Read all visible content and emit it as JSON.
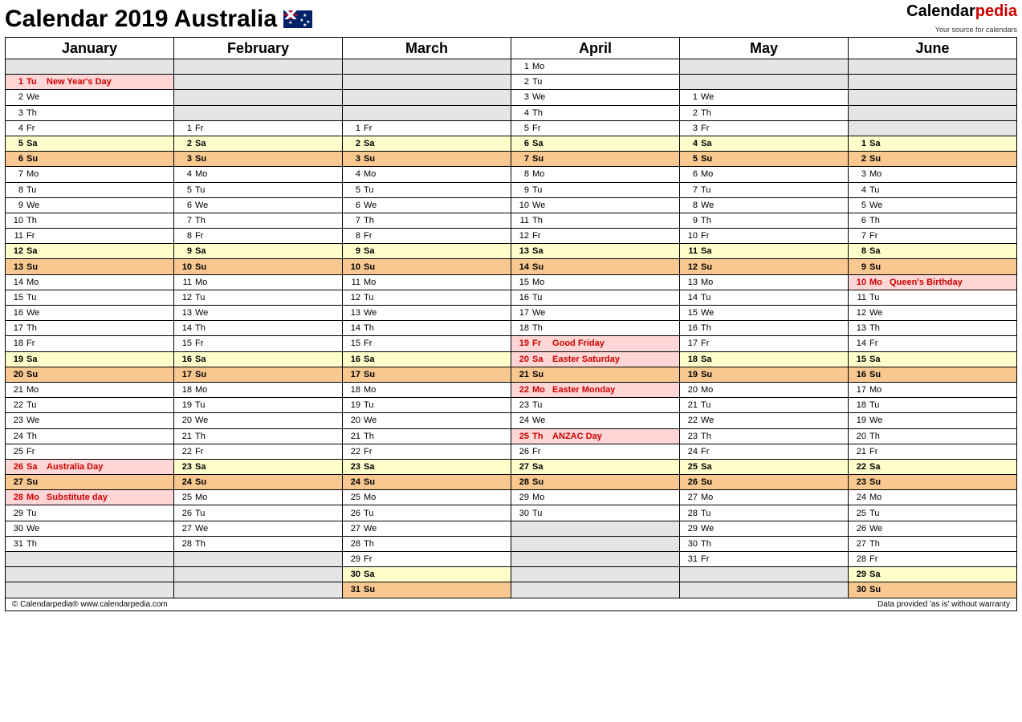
{
  "title": "Calendar 2019 Australia",
  "brand": {
    "name": "Calendar",
    "suffix": "pedia",
    "tagline": "Your source for calendars"
  },
  "footer": {
    "left": "© Calendarpedia®   www.calendarpedia.com",
    "right": "Data provided 'as is' without warranty"
  },
  "months": [
    "January",
    "February",
    "March",
    "April",
    "May",
    "June"
  ],
  "rows": 35,
  "grid": {
    "January": [
      null,
      {
        "d": 1,
        "w": "Tu",
        "t": "hol",
        "lbl": "New Year's Day"
      },
      {
        "d": 2,
        "w": "We"
      },
      {
        "d": 3,
        "w": "Th"
      },
      {
        "d": 4,
        "w": "Fr"
      },
      {
        "d": 5,
        "w": "Sa",
        "t": "sat"
      },
      {
        "d": 6,
        "w": "Su",
        "t": "sun"
      },
      {
        "d": 7,
        "w": "Mo"
      },
      {
        "d": 8,
        "w": "Tu"
      },
      {
        "d": 9,
        "w": "We"
      },
      {
        "d": 10,
        "w": "Th"
      },
      {
        "d": 11,
        "w": "Fr"
      },
      {
        "d": 12,
        "w": "Sa",
        "t": "sat"
      },
      {
        "d": 13,
        "w": "Su",
        "t": "sun"
      },
      {
        "d": 14,
        "w": "Mo"
      },
      {
        "d": 15,
        "w": "Tu"
      },
      {
        "d": 16,
        "w": "We"
      },
      {
        "d": 17,
        "w": "Th"
      },
      {
        "d": 18,
        "w": "Fr"
      },
      {
        "d": 19,
        "w": "Sa",
        "t": "sat"
      },
      {
        "d": 20,
        "w": "Su",
        "t": "sun"
      },
      {
        "d": 21,
        "w": "Mo"
      },
      {
        "d": 22,
        "w": "Tu"
      },
      {
        "d": 23,
        "w": "We"
      },
      {
        "d": 24,
        "w": "Th"
      },
      {
        "d": 25,
        "w": "Fr"
      },
      {
        "d": 26,
        "w": "Sa",
        "t": "hol",
        "lbl": "Australia Day"
      },
      {
        "d": 27,
        "w": "Su",
        "t": "sun"
      },
      {
        "d": 28,
        "w": "Mo",
        "t": "hol",
        "lbl": "Substitute day"
      },
      {
        "d": 29,
        "w": "Tu"
      },
      {
        "d": 30,
        "w": "We"
      },
      {
        "d": 31,
        "w": "Th"
      },
      null,
      null,
      null
    ],
    "February": [
      null,
      null,
      null,
      null,
      {
        "d": 1,
        "w": "Fr"
      },
      {
        "d": 2,
        "w": "Sa",
        "t": "sat"
      },
      {
        "d": 3,
        "w": "Su",
        "t": "sun"
      },
      {
        "d": 4,
        "w": "Mo"
      },
      {
        "d": 5,
        "w": "Tu"
      },
      {
        "d": 6,
        "w": "We"
      },
      {
        "d": 7,
        "w": "Th"
      },
      {
        "d": 8,
        "w": "Fr"
      },
      {
        "d": 9,
        "w": "Sa",
        "t": "sat"
      },
      {
        "d": 10,
        "w": "Su",
        "t": "sun"
      },
      {
        "d": 11,
        "w": "Mo"
      },
      {
        "d": 12,
        "w": "Tu"
      },
      {
        "d": 13,
        "w": "We"
      },
      {
        "d": 14,
        "w": "Th"
      },
      {
        "d": 15,
        "w": "Fr"
      },
      {
        "d": 16,
        "w": "Sa",
        "t": "sat"
      },
      {
        "d": 17,
        "w": "Su",
        "t": "sun"
      },
      {
        "d": 18,
        "w": "Mo"
      },
      {
        "d": 19,
        "w": "Tu"
      },
      {
        "d": 20,
        "w": "We"
      },
      {
        "d": 21,
        "w": "Th"
      },
      {
        "d": 22,
        "w": "Fr"
      },
      {
        "d": 23,
        "w": "Sa",
        "t": "sat"
      },
      {
        "d": 24,
        "w": "Su",
        "t": "sun"
      },
      {
        "d": 25,
        "w": "Mo"
      },
      {
        "d": 26,
        "w": "Tu"
      },
      {
        "d": 27,
        "w": "We"
      },
      {
        "d": 28,
        "w": "Th"
      },
      null,
      null,
      null
    ],
    "March": [
      null,
      null,
      null,
      null,
      {
        "d": 1,
        "w": "Fr"
      },
      {
        "d": 2,
        "w": "Sa",
        "t": "sat"
      },
      {
        "d": 3,
        "w": "Su",
        "t": "sun"
      },
      {
        "d": 4,
        "w": "Mo"
      },
      {
        "d": 5,
        "w": "Tu"
      },
      {
        "d": 6,
        "w": "We"
      },
      {
        "d": 7,
        "w": "Th"
      },
      {
        "d": 8,
        "w": "Fr"
      },
      {
        "d": 9,
        "w": "Sa",
        "t": "sat"
      },
      {
        "d": 10,
        "w": "Su",
        "t": "sun"
      },
      {
        "d": 11,
        "w": "Mo"
      },
      {
        "d": 12,
        "w": "Tu"
      },
      {
        "d": 13,
        "w": "We"
      },
      {
        "d": 14,
        "w": "Th"
      },
      {
        "d": 15,
        "w": "Fr"
      },
      {
        "d": 16,
        "w": "Sa",
        "t": "sat"
      },
      {
        "d": 17,
        "w": "Su",
        "t": "sun"
      },
      {
        "d": 18,
        "w": "Mo"
      },
      {
        "d": 19,
        "w": "Tu"
      },
      {
        "d": 20,
        "w": "We"
      },
      {
        "d": 21,
        "w": "Th"
      },
      {
        "d": 22,
        "w": "Fr"
      },
      {
        "d": 23,
        "w": "Sa",
        "t": "sat"
      },
      {
        "d": 24,
        "w": "Su",
        "t": "sun"
      },
      {
        "d": 25,
        "w": "Mo"
      },
      {
        "d": 26,
        "w": "Tu"
      },
      {
        "d": 27,
        "w": "We"
      },
      {
        "d": 28,
        "w": "Th"
      },
      {
        "d": 29,
        "w": "Fr"
      },
      {
        "d": 30,
        "w": "Sa",
        "t": "sat"
      },
      {
        "d": 31,
        "w": "Su",
        "t": "sun"
      }
    ],
    "April": [
      {
        "d": 1,
        "w": "Mo"
      },
      {
        "d": 2,
        "w": "Tu"
      },
      {
        "d": 3,
        "w": "We"
      },
      {
        "d": 4,
        "w": "Th"
      },
      {
        "d": 5,
        "w": "Fr"
      },
      {
        "d": 6,
        "w": "Sa",
        "t": "sat"
      },
      {
        "d": 7,
        "w": "Su",
        "t": "sun"
      },
      {
        "d": 8,
        "w": "Mo"
      },
      {
        "d": 9,
        "w": "Tu"
      },
      {
        "d": 10,
        "w": "We"
      },
      {
        "d": 11,
        "w": "Th"
      },
      {
        "d": 12,
        "w": "Fr"
      },
      {
        "d": 13,
        "w": "Sa",
        "t": "sat"
      },
      {
        "d": 14,
        "w": "Su",
        "t": "sun"
      },
      {
        "d": 15,
        "w": "Mo"
      },
      {
        "d": 16,
        "w": "Tu"
      },
      {
        "d": 17,
        "w": "We"
      },
      {
        "d": 18,
        "w": "Th"
      },
      {
        "d": 19,
        "w": "Fr",
        "t": "hol",
        "lbl": "Good Friday"
      },
      {
        "d": 20,
        "w": "Sa",
        "t": "hol",
        "lbl": "Easter Saturday"
      },
      {
        "d": 21,
        "w": "Su",
        "t": "sun"
      },
      {
        "d": 22,
        "w": "Mo",
        "t": "hol",
        "lbl": "Easter Monday"
      },
      {
        "d": 23,
        "w": "Tu"
      },
      {
        "d": 24,
        "w": "We"
      },
      {
        "d": 25,
        "w": "Th",
        "t": "hol",
        "lbl": "ANZAC Day"
      },
      {
        "d": 26,
        "w": "Fr"
      },
      {
        "d": 27,
        "w": "Sa",
        "t": "sat"
      },
      {
        "d": 28,
        "w": "Su",
        "t": "sun"
      },
      {
        "d": 29,
        "w": "Mo"
      },
      {
        "d": 30,
        "w": "Tu"
      },
      null,
      null,
      null,
      null,
      null
    ],
    "May": [
      null,
      null,
      {
        "d": 1,
        "w": "We"
      },
      {
        "d": 2,
        "w": "Th"
      },
      {
        "d": 3,
        "w": "Fr"
      },
      {
        "d": 4,
        "w": "Sa",
        "t": "sat"
      },
      {
        "d": 5,
        "w": "Su",
        "t": "sun"
      },
      {
        "d": 6,
        "w": "Mo"
      },
      {
        "d": 7,
        "w": "Tu"
      },
      {
        "d": 8,
        "w": "We"
      },
      {
        "d": 9,
        "w": "Th"
      },
      {
        "d": 10,
        "w": "Fr"
      },
      {
        "d": 11,
        "w": "Sa",
        "t": "sat"
      },
      {
        "d": 12,
        "w": "Su",
        "t": "sun"
      },
      {
        "d": 13,
        "w": "Mo"
      },
      {
        "d": 14,
        "w": "Tu"
      },
      {
        "d": 15,
        "w": "We"
      },
      {
        "d": 16,
        "w": "Th"
      },
      {
        "d": 17,
        "w": "Fr"
      },
      {
        "d": 18,
        "w": "Sa",
        "t": "sat"
      },
      {
        "d": 19,
        "w": "Su",
        "t": "sun"
      },
      {
        "d": 20,
        "w": "Mo"
      },
      {
        "d": 21,
        "w": "Tu"
      },
      {
        "d": 22,
        "w": "We"
      },
      {
        "d": 23,
        "w": "Th"
      },
      {
        "d": 24,
        "w": "Fr"
      },
      {
        "d": 25,
        "w": "Sa",
        "t": "sat"
      },
      {
        "d": 26,
        "w": "Su",
        "t": "sun"
      },
      {
        "d": 27,
        "w": "Mo"
      },
      {
        "d": 28,
        "w": "Tu"
      },
      {
        "d": 29,
        "w": "We"
      },
      {
        "d": 30,
        "w": "Th"
      },
      {
        "d": 31,
        "w": "Fr"
      },
      null,
      null
    ],
    "June": [
      null,
      null,
      null,
      null,
      null,
      {
        "d": 1,
        "w": "Sa",
        "t": "sat"
      },
      {
        "d": 2,
        "w": "Su",
        "t": "sun"
      },
      {
        "d": 3,
        "w": "Mo"
      },
      {
        "d": 4,
        "w": "Tu"
      },
      {
        "d": 5,
        "w": "We"
      },
      {
        "d": 6,
        "w": "Th"
      },
      {
        "d": 7,
        "w": "Fr"
      },
      {
        "d": 8,
        "w": "Sa",
        "t": "sat"
      },
      {
        "d": 9,
        "w": "Su",
        "t": "sun"
      },
      {
        "d": 10,
        "w": "Mo",
        "t": "hol",
        "lbl": "Queen's Birthday"
      },
      {
        "d": 11,
        "w": "Tu"
      },
      {
        "d": 12,
        "w": "We"
      },
      {
        "d": 13,
        "w": "Th"
      },
      {
        "d": 14,
        "w": "Fr"
      },
      {
        "d": 15,
        "w": "Sa",
        "t": "sat"
      },
      {
        "d": 16,
        "w": "Su",
        "t": "sun"
      },
      {
        "d": 17,
        "w": "Mo"
      },
      {
        "d": 18,
        "w": "Tu"
      },
      {
        "d": 19,
        "w": "We"
      },
      {
        "d": 20,
        "w": "Th"
      },
      {
        "d": 21,
        "w": "Fr"
      },
      {
        "d": 22,
        "w": "Sa",
        "t": "sat"
      },
      {
        "d": 23,
        "w": "Su",
        "t": "sun"
      },
      {
        "d": 24,
        "w": "Mo"
      },
      {
        "d": 25,
        "w": "Tu"
      },
      {
        "d": 26,
        "w": "We"
      },
      {
        "d": 27,
        "w": "Th"
      },
      {
        "d": 28,
        "w": "Fr"
      },
      {
        "d": 29,
        "w": "Sa",
        "t": "sat"
      },
      {
        "d": 30,
        "w": "Su",
        "t": "sun"
      }
    ]
  }
}
